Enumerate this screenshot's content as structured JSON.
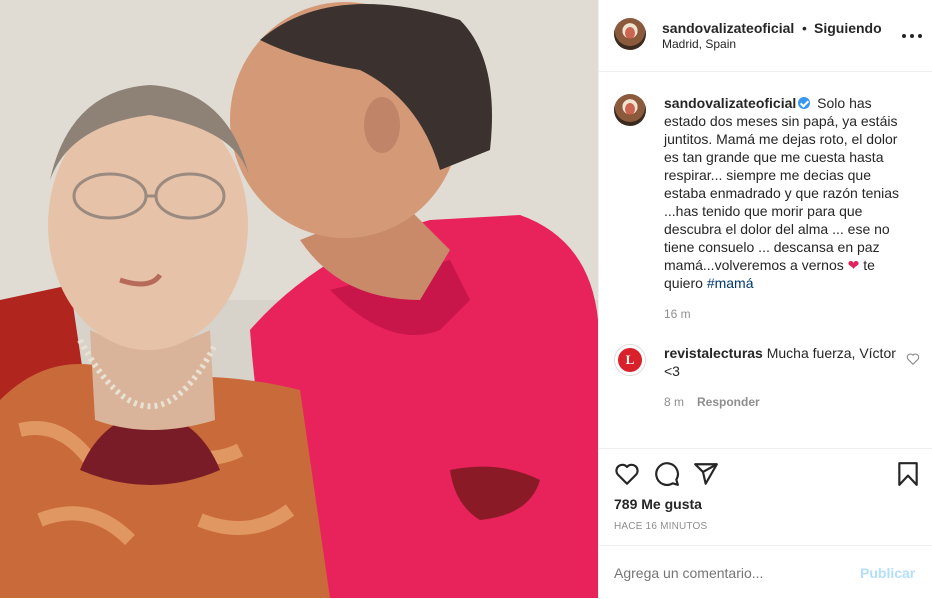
{
  "header": {
    "username": "sandovalizateoficial",
    "dot": "•",
    "follow_status": "Siguiendo",
    "location": "Madrid, Spain"
  },
  "caption": {
    "username": "sandovalizateoficial",
    "text_before_emoji": "Solo has estado dos meses sin papá, ya estáis juntitos. Mamá me dejas roto, el dolor es tan grande que me cuesta hasta respirar... siempre me decias que estaba enmadrado y que razón tenias ...has tenido que morir para que descubra el dolor del alma ... ese no tiene consuelo ... descansa en paz mamá...volveremos a vernos",
    "emoji": "❤",
    "text_after_emoji": "te quiero",
    "hashtag": "#mamá",
    "time": "16 m"
  },
  "comment": {
    "avatar_letter": "L",
    "username": "revistalecturas",
    "text": "Mucha fuerza, Víctor <3",
    "time": "8 m",
    "reply_label": "Responder"
  },
  "actions": {
    "likes": "789 Me gusta",
    "posted": "HACE 16 MINUTOS"
  },
  "add_comment": {
    "placeholder": "Agrega un comentario...",
    "publish_label": "Publicar"
  },
  "icons": {
    "like": "heart-icon",
    "comment": "comment-bubble-icon",
    "share": "paper-plane-icon",
    "save": "bookmark-icon",
    "more": "more-options-icon",
    "verified": "verified-badge-icon"
  },
  "colors": {
    "verified": "#3897f0",
    "publish_disabled": "#b2dffc",
    "hashtag": "#00376b",
    "muted": "#8e8e8e",
    "lecturas_red": "#d8212a"
  }
}
